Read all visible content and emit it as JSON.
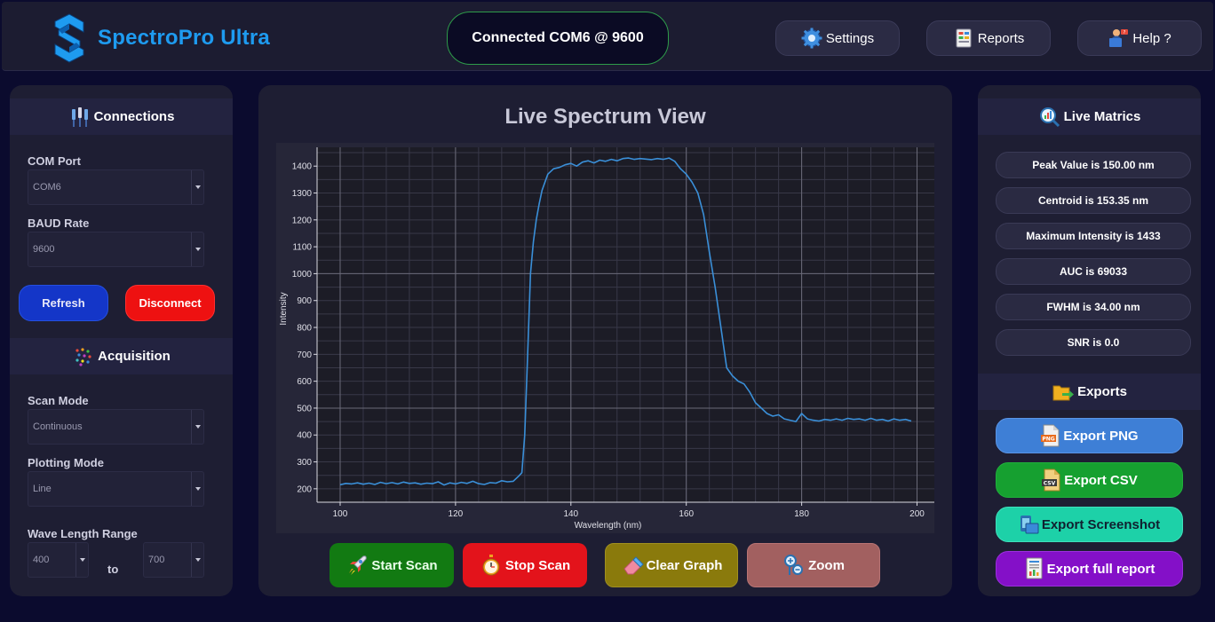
{
  "header": {
    "app_title": "SpectroPro Ultra",
    "connection_status": "Connected COM6 @ 9600",
    "settings_label": "Settings",
    "reports_label": "Reports",
    "help_label": "Help ?"
  },
  "left_panel": {
    "connections_title": "Connections",
    "com_port_label": "COM Port",
    "com_port_value": "COM6",
    "baud_label": "BAUD Rate",
    "baud_value": "9600",
    "refresh_label": "Refresh",
    "disconnect_label": "Disconnect",
    "acquisition_title": "Acquisition",
    "scan_mode_label": "Scan Mode",
    "scan_mode_value": "Continuous",
    "plotting_mode_label": "Plotting Mode",
    "plotting_mode_value": "Line",
    "wave_range_label": "Wave Length Range",
    "wave_min": "400",
    "to_label": "to",
    "wave_max": "700"
  },
  "middle_panel": {
    "title": "Live Spectrum View",
    "start_label": "Start Scan",
    "stop_label": "Stop Scan",
    "clear_label": "Clear Graph",
    "zoom_label": "Zoom"
  },
  "right_panel": {
    "metrics_title": "Live Matrics",
    "metrics": [
      "Peak Value is 150.00 nm",
      "Centroid is 153.35 nm",
      "Maximum Intensity is 1433",
      "AUC is 69033",
      "FWHM is 34.00 nm",
      "SNR is 0.0"
    ],
    "exports_title": "Exports",
    "export_png": "Export PNG",
    "export_csv": "Export CSV",
    "export_screenshot": "Export Screenshot",
    "export_report": "Export full report"
  },
  "colors": {
    "accent": "#1e9bf0",
    "line": "#3a8fd8",
    "refresh": "#1436c8",
    "disconnect": "#ee1111",
    "start": "#127a12",
    "stop": "#e3131b",
    "clear": "#8a7a0c",
    "zoom": "#a26060",
    "export_png": "#3e7fd6",
    "export_csv": "#16a030",
    "export_screenshot": "#1dd1a8",
    "export_report": "#8410c8"
  },
  "chart_data": {
    "type": "line",
    "xlabel": "Wavelength (nm)",
    "ylabel": "Intensity",
    "xlim": [
      96,
      203
    ],
    "ylim": [
      150,
      1470
    ],
    "xticks": [
      100,
      120,
      140,
      160,
      180,
      200
    ],
    "yticks": [
      200,
      300,
      400,
      500,
      600,
      700,
      800,
      900,
      1000,
      1100,
      1200,
      1300,
      1400
    ],
    "grid": true,
    "series": [
      {
        "x": [
          100,
          101,
          102,
          103,
          104,
          105,
          106,
          107,
          108,
          109,
          110,
          111,
          112,
          113,
          114,
          115,
          116,
          117,
          118,
          119,
          120,
          121,
          122,
          123,
          124,
          125,
          126,
          127,
          128,
          129,
          130,
          131,
          131.5,
          132,
          132.5,
          133,
          133.5,
          134,
          134.5,
          135,
          136,
          137,
          138,
          139,
          140,
          141,
          142,
          143,
          144,
          145,
          146,
          147,
          148,
          149,
          150,
          151,
          152,
          153,
          154,
          155,
          156,
          157,
          158,
          159,
          160,
          161,
          162,
          163,
          164,
          165,
          166,
          167,
          168,
          169,
          170,
          171,
          172,
          173,
          174,
          175,
          176,
          177,
          178,
          179,
          180,
          181,
          182,
          183,
          184,
          185,
          186,
          187,
          188,
          189,
          190,
          191,
          192,
          193,
          194,
          195,
          196,
          197,
          198,
          199
        ],
        "y": [
          215,
          220,
          218,
          222,
          217,
          221,
          216,
          224,
          219,
          223,
          218,
          225,
          220,
          222,
          217,
          221,
          219,
          226,
          214,
          222,
          218,
          224,
          220,
          228,
          219,
          216,
          223,
          221,
          230,
          226,
          228,
          248,
          260,
          400,
          700,
          1000,
          1120,
          1200,
          1260,
          1310,
          1370,
          1390,
          1395,
          1405,
          1410,
          1400,
          1415,
          1420,
          1412,
          1422,
          1418,
          1425,
          1420,
          1428,
          1430,
          1425,
          1428,
          1426,
          1424,
          1428,
          1425,
          1430,
          1418,
          1390,
          1370,
          1340,
          1300,
          1220,
          1080,
          950,
          800,
          650,
          620,
          600,
          590,
          560,
          520,
          500,
          480,
          470,
          475,
          460,
          455,
          450,
          480,
          460,
          455,
          452,
          458,
          455,
          460,
          455,
          462,
          458,
          460,
          455,
          462,
          455,
          458,
          452,
          460,
          455,
          458,
          452
        ]
      }
    ]
  }
}
